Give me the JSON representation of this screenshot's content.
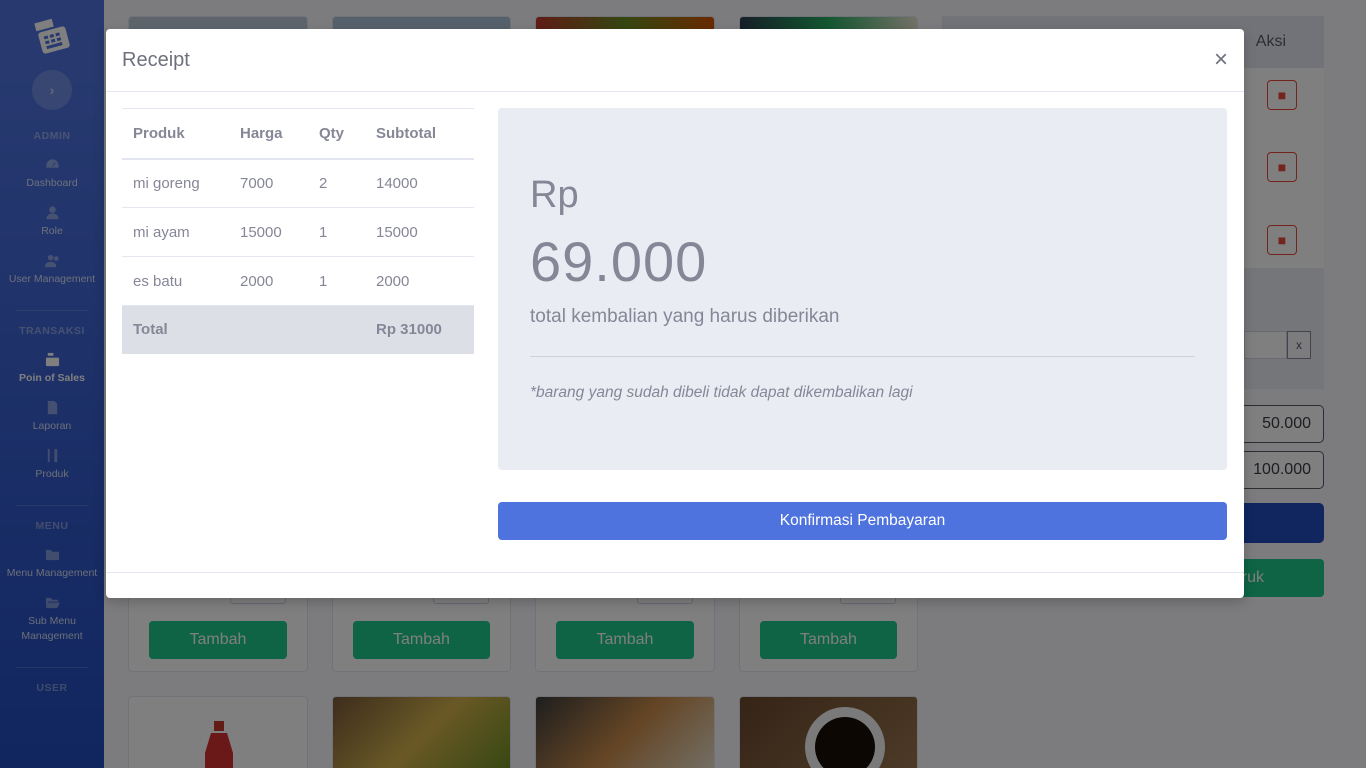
{
  "sidebar": {
    "sections": [
      {
        "heading": "ADMIN",
        "items": [
          {
            "label": "Dashboard",
            "icon": "dashboard-icon"
          },
          {
            "label": "Role",
            "icon": "user-icon"
          },
          {
            "label": "User Management",
            "icon": "users-icon"
          }
        ]
      },
      {
        "heading": "TRANSAKSI",
        "items": [
          {
            "label": "Poin of Sales",
            "icon": "cash-register-icon"
          },
          {
            "label": "Laporan",
            "icon": "file-icon"
          },
          {
            "label": "Produk",
            "icon": "utensils-icon"
          }
        ]
      },
      {
        "heading": "MENU",
        "items": [
          {
            "label": "Menu Management",
            "icon": "folder-icon"
          },
          {
            "label": "Sub Menu Management",
            "icon": "folder-open-icon"
          }
        ]
      },
      {
        "heading": "USER",
        "items": []
      }
    ]
  },
  "background": {
    "add_button_label": "Tambah",
    "cart_header_action": "Aksi",
    "clear_label": "x",
    "paid_value": "50.000",
    "change_value": "100.000",
    "print_button_label": "Struk"
  },
  "modal": {
    "title": "Receipt",
    "close_label": "×",
    "table": {
      "headers": [
        "Produk",
        "Harga",
        "Qty",
        "Subtotal"
      ],
      "rows": [
        [
          "mi goreng",
          "7000",
          "2",
          "14000"
        ],
        [
          "mi ayam",
          "15000",
          "1",
          "15000"
        ],
        [
          "es batu",
          "2000",
          "1",
          "2000"
        ]
      ],
      "total_label": "Total",
      "total_value": "Rp 31000"
    },
    "summary": {
      "currency": "Rp",
      "amount": "69.000",
      "description": "total kembalian yang harus diberikan",
      "note": "*barang yang sudah dibeli tidak dapat dikembalikan lagi"
    },
    "confirm_button_label": "Konfirmasi Pembayaran"
  },
  "colors": {
    "primary": "#4e73df",
    "success": "#1cc88a",
    "danger": "#e74a3b"
  }
}
